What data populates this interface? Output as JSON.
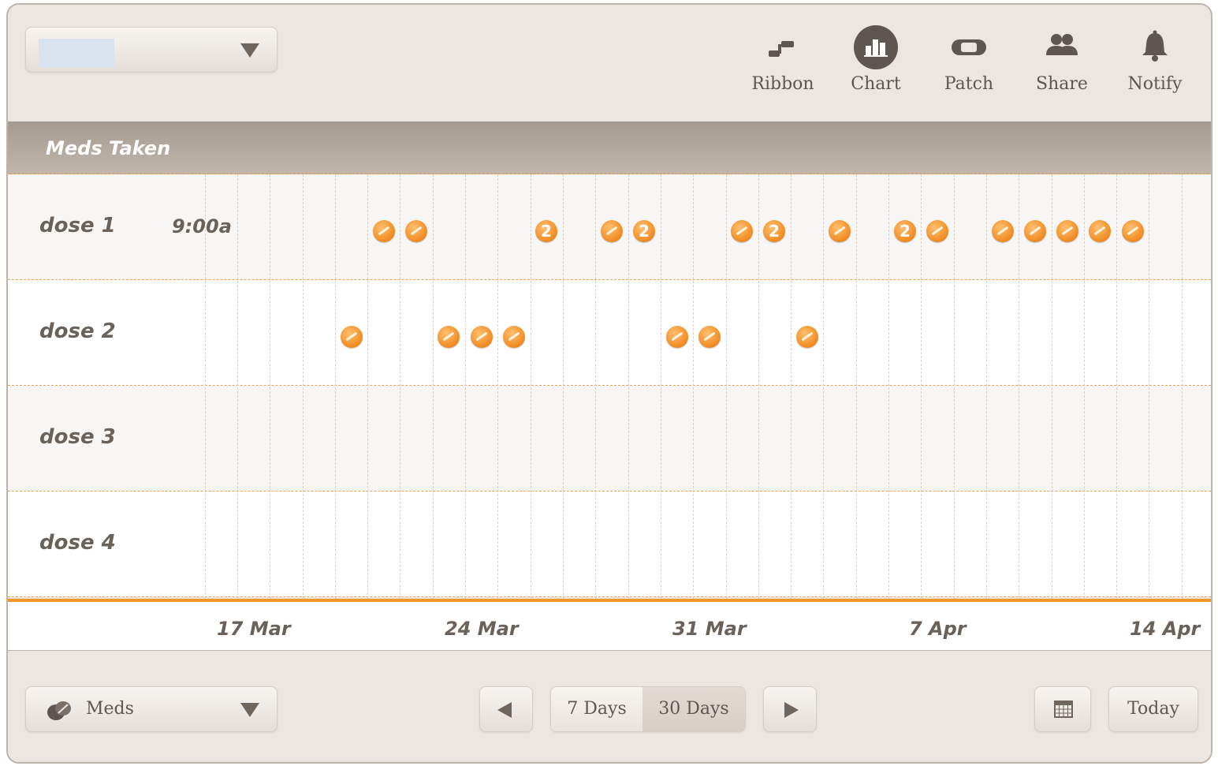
{
  "header": {
    "profile_select": {
      "value": "",
      "icon": "chevron-down-icon"
    },
    "nav": [
      {
        "label": "Ribbon",
        "icon": "ribbon-icon",
        "active": false
      },
      {
        "label": "Chart",
        "icon": "chart-icon",
        "active": true
      },
      {
        "label": "Patch",
        "icon": "patch-icon",
        "active": false
      },
      {
        "label": "Share",
        "icon": "share-icon",
        "active": false
      },
      {
        "label": "Notify",
        "icon": "bell-icon",
        "active": false
      }
    ]
  },
  "section": {
    "title": "Meds Taken"
  },
  "doses": [
    {
      "label": "dose 1",
      "time": "9:00a"
    },
    {
      "label": "dose 2",
      "time": ""
    },
    {
      "label": "dose 3",
      "time": ""
    },
    {
      "label": "dose 4",
      "time": ""
    }
  ],
  "timeline": {
    "start_date": "2014-03-17",
    "days_visible": 30,
    "axis_labels": [
      "17 Mar",
      "24 Mar",
      "31 Mar",
      "7 Apr",
      "14 Apr"
    ],
    "events": {
      "dose 1": [
        {
          "date": "21 Mar",
          "count": 1
        },
        {
          "date": "22 Mar",
          "count": 1
        },
        {
          "date": "26 Mar",
          "count": 2
        },
        {
          "date": "28 Mar",
          "count": 1
        },
        {
          "date": "29 Mar",
          "count": 2
        },
        {
          "date": "1 Apr",
          "count": 1
        },
        {
          "date": "2 Apr",
          "count": 2
        },
        {
          "date": "4 Apr",
          "count": 1
        },
        {
          "date": "6 Apr",
          "count": 2
        },
        {
          "date": "7 Apr",
          "count": 1
        },
        {
          "date": "9 Apr",
          "count": 1
        },
        {
          "date": "10 Apr",
          "count": 1
        },
        {
          "date": "11 Apr",
          "count": 1
        },
        {
          "date": "12 Apr",
          "count": 1
        },
        {
          "date": "13 Apr",
          "count": 1
        }
      ],
      "dose 2": [
        {
          "date": "20 Mar",
          "count": 1
        },
        {
          "date": "23 Mar",
          "count": 1
        },
        {
          "date": "24 Mar",
          "count": 1
        },
        {
          "date": "25 Mar",
          "count": 1
        },
        {
          "date": "30 Mar",
          "count": 1
        },
        {
          "date": "31 Mar",
          "count": 1
        },
        {
          "date": "3 Apr",
          "count": 1
        }
      ],
      "dose 3": [],
      "dose 4": []
    }
  },
  "footer": {
    "meds_select": {
      "label": "Meds",
      "icon": "pills-icon"
    },
    "range_options": [
      "7 Days",
      "30 Days"
    ],
    "selected_range": "30 Days",
    "today_label": "Today",
    "calendar_icon": "calendar-icon",
    "prev_icon": "arrow-left-icon",
    "next_icon": "arrow-right-icon"
  },
  "colors": {
    "accent": "#f39426",
    "pill": "#f08a20",
    "text": "#6a625a",
    "header_band": "#b3a89d"
  }
}
